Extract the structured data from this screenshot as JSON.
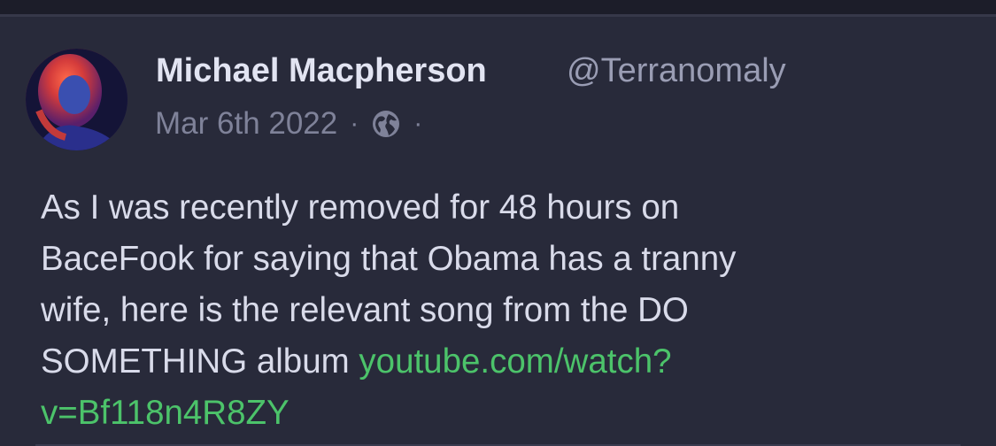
{
  "post": {
    "author": {
      "display_name": "Michael Macpherson",
      "handle": "@Terranomaly"
    },
    "date": "Mar 6th 2022",
    "separator": "·",
    "visibility_icon": "globe-icon",
    "text_lines": [
      "As I was recently removed for 48 hours on",
      "BaceFook for saying that Obama has a tranny",
      "wife, here is the relevant song from the DO",
      "SOMETHING album "
    ],
    "link": {
      "line1": "youtube.com/watch?",
      "line2": "v=Bf118n4R8ZY"
    }
  },
  "colors": {
    "background": "#282a3a",
    "link": "#4cc36a",
    "name": "#e2e4f2",
    "secondary": "#7f8299"
  }
}
